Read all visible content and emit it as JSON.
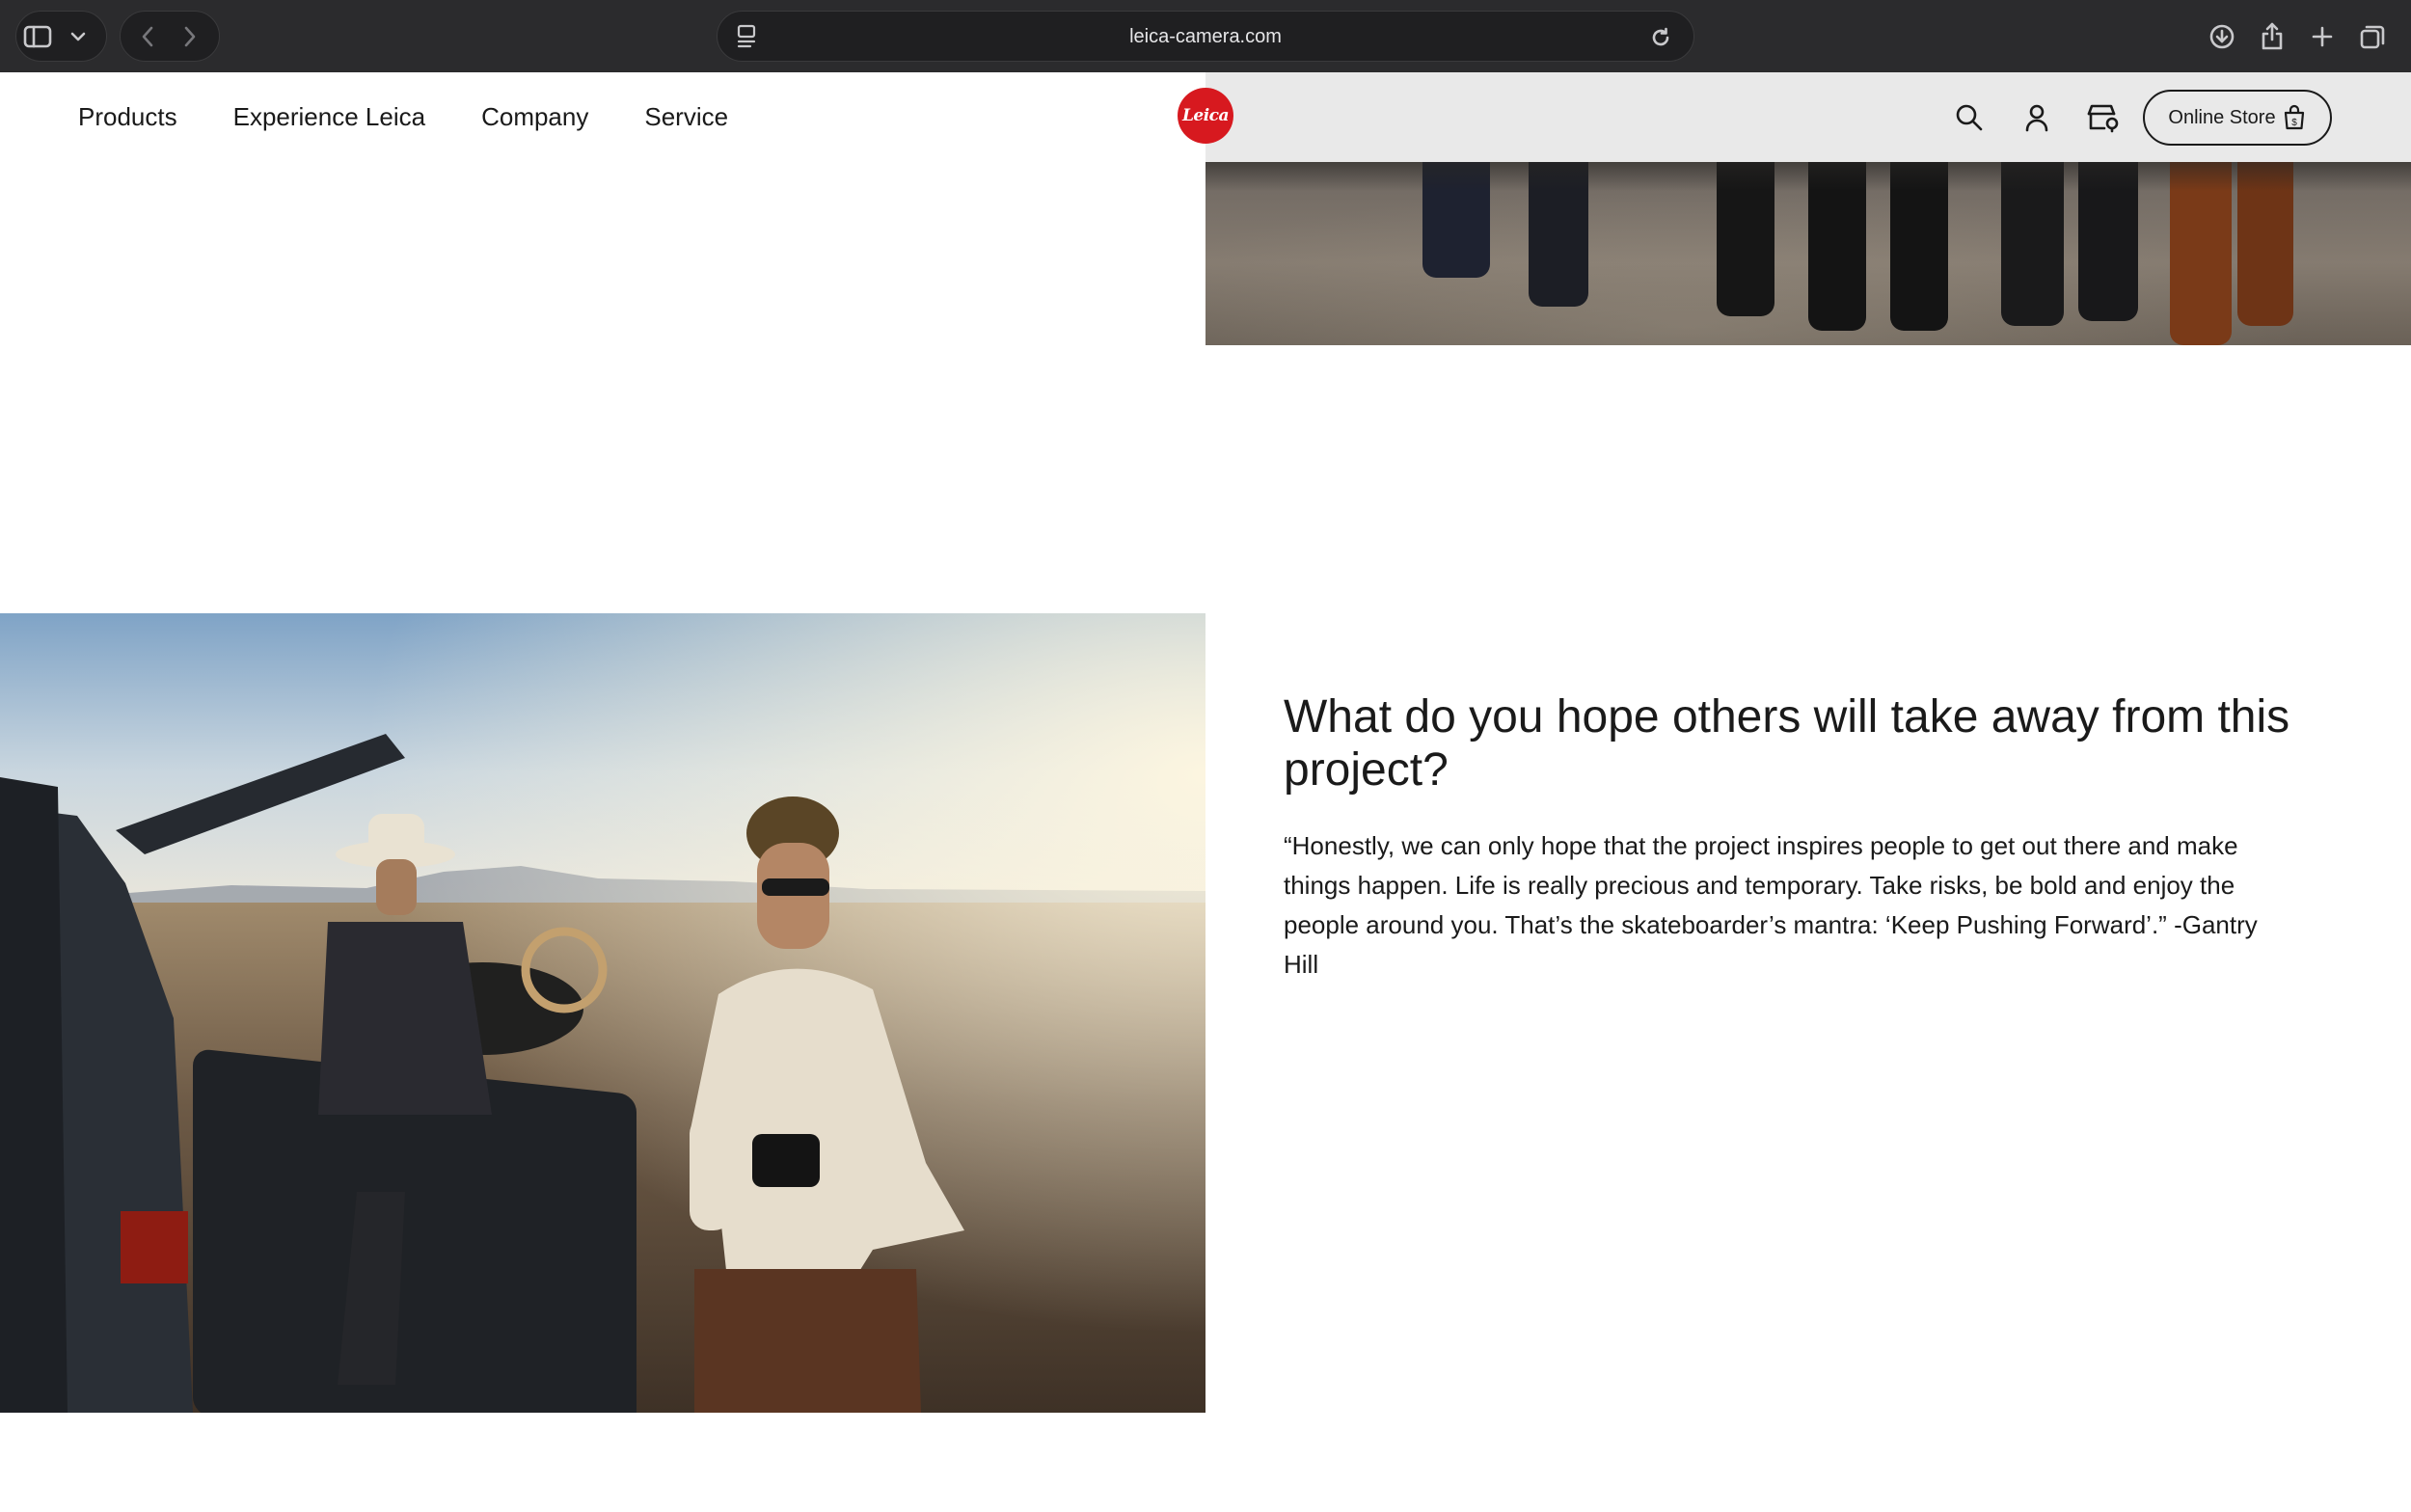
{
  "browser": {
    "url": "leica-camera.com",
    "icons": [
      "sidebar-icon",
      "chevron-down-icon",
      "back-icon",
      "forward-icon",
      "page-menu-icon",
      "reload-icon",
      "download-icon",
      "share-icon",
      "new-tab-icon",
      "tabs-overview-icon"
    ]
  },
  "header": {
    "nav": [
      "Products",
      "Experience Leica",
      "Company",
      "Service"
    ],
    "logo_text": "Leica",
    "store_label": "Online Store",
    "icons": [
      "search-icon",
      "account-icon",
      "store-locator-icon",
      "shopping-bag-icon"
    ]
  },
  "article": {
    "question": "What do you hope others will take away from this project?",
    "answer": "“Honestly, we can only hope that the project inspires people to get out there and make things happen. Life is really precious and temporary. Take risks, be bold and enjoy the people around you.  That’s the skateboarder’s mantra: ‘Keep Pushing Forward’.” -Gantry Hill"
  },
  "colors": {
    "brand_red": "#d7191f",
    "text": "#1a1a1a",
    "chrome_bg": "#2b2b2d"
  }
}
